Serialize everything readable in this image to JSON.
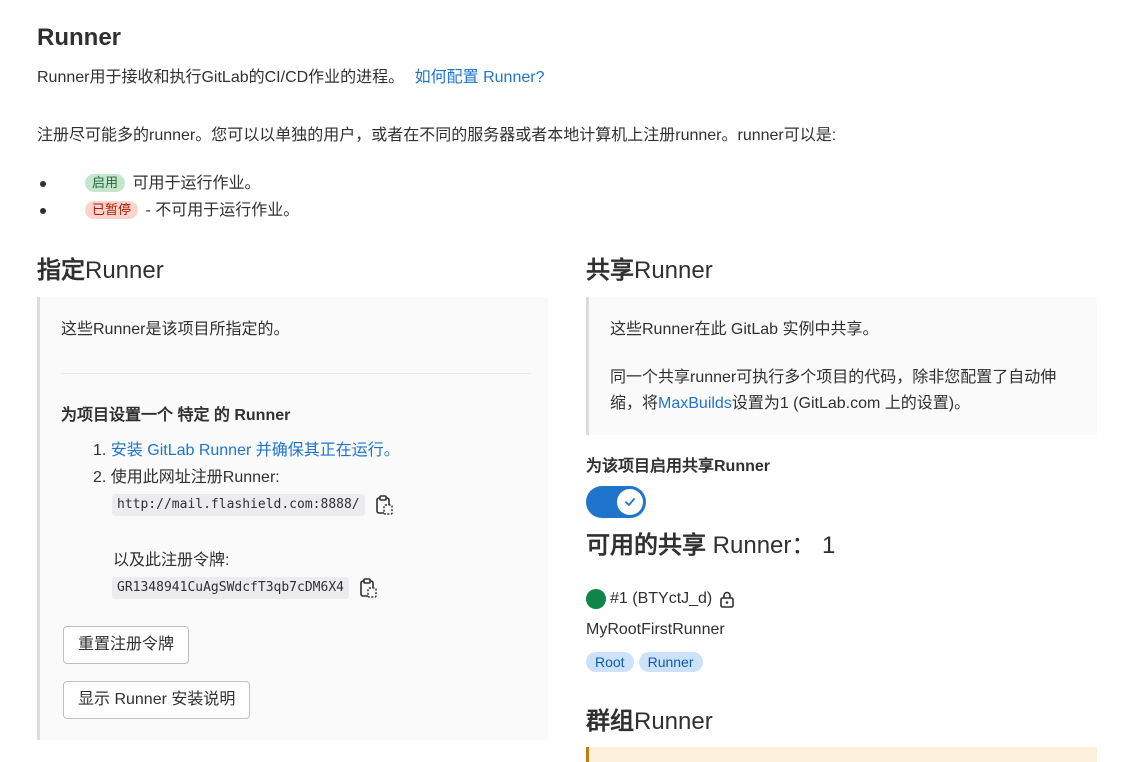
{
  "header": {
    "title": "Runner",
    "intro_text": "Runner用于接收和执行GitLab的CI/CD作业的进程。",
    "intro_link": "如何配置 Runner?",
    "register_text": "注册尽可能多的runner。您可以以单独的用户，或者在不同的服务器或者本地计算机上注册runner。runner可以是:",
    "states": [
      {
        "badge": "启用",
        "text": "可用于运行作业。"
      },
      {
        "badge": "已暂停",
        "text": "- 不可用于运行作业。"
      }
    ]
  },
  "specific": {
    "title_bold": "指定",
    "title_rest": "Runner",
    "description": "这些Runner是该项目所指定的。",
    "setup_heading": "为项目设置一个 特定 的 Runner",
    "step1_link": "安装 GitLab Runner 并确保其正在运行。",
    "step2_text": "使用此网址注册Runner:",
    "url": "http://mail.flashield.com:8888/",
    "token_label": "以及此注册令牌:",
    "token": "GR1348941CuAgSWdcfT3qb7cDM6X4",
    "reset_button": "重置注册令牌",
    "show_instructions_button": "显示 Runner 安装说明"
  },
  "shared": {
    "title_bold": "共享",
    "title_rest": "Runner",
    "description": "这些Runner在此 GitLab 实例中共享。",
    "note_before": "同一个共享runner可执行多个项目的代码，除非您配置了自动伸缩，将",
    "note_link": "MaxBuilds",
    "note_after": "设置为1 (GitLab.com 上的设置)。",
    "toggle_label": "为该项目启用共享Runner",
    "toggle_on": true,
    "available_bold": "可用的共享",
    "available_rest": " Runner： 1",
    "runner_id": "#1 (BTYctJ_d)",
    "runner_name": "MyRootFirstRunner",
    "tags": [
      "Root",
      "Runner"
    ]
  },
  "group": {
    "title_bold": "群组",
    "title_rest": "Runner"
  },
  "colors": {
    "link": "#1f75cb",
    "active_badge_bg": "#c3e6cd",
    "paused_badge_bg": "#fdd4cd",
    "toggle": "#1f75cb",
    "online": "#108548"
  }
}
